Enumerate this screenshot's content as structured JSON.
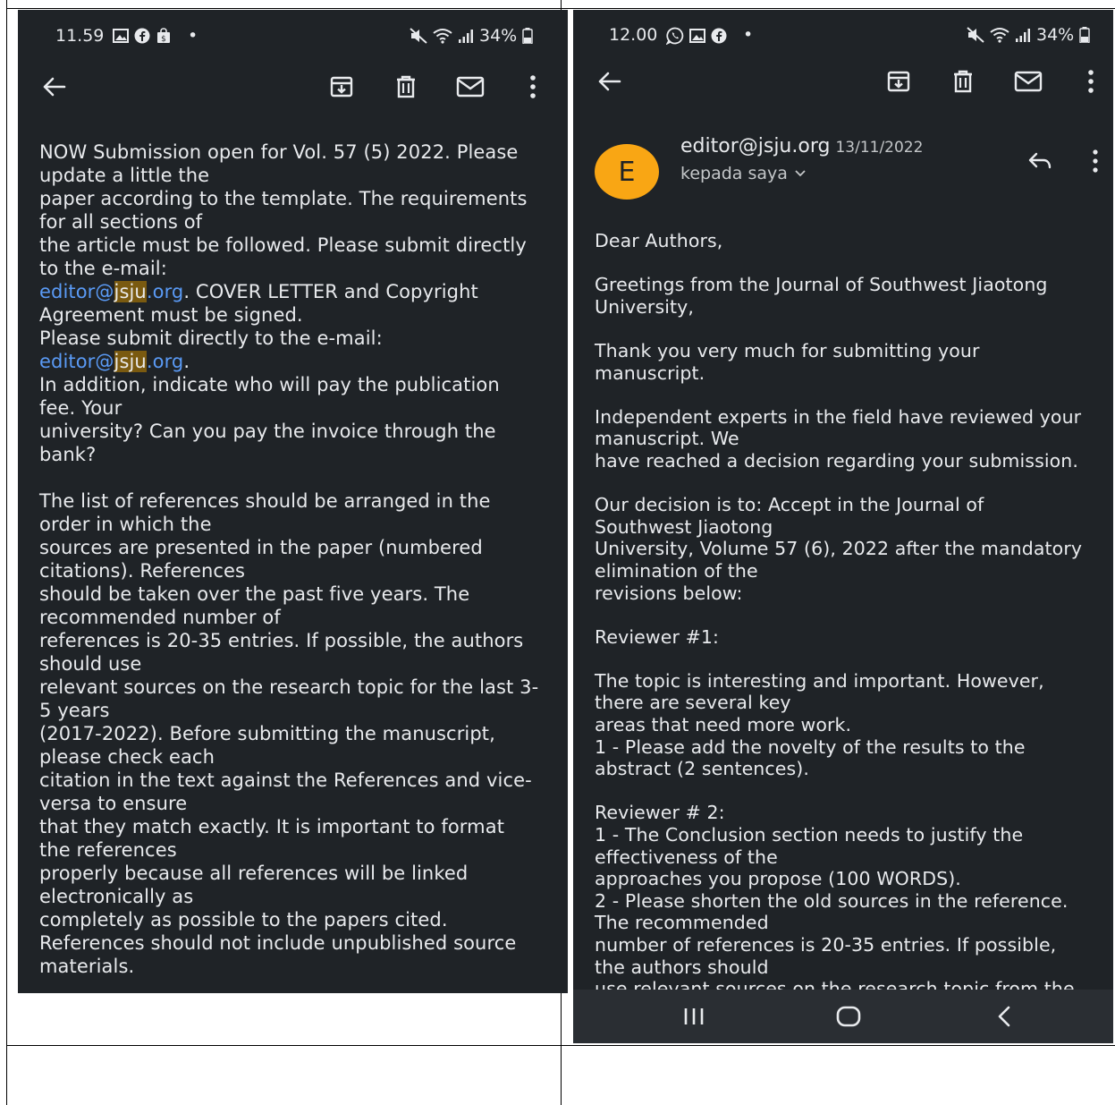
{
  "left_phone": {
    "status": {
      "time": "11.59",
      "dot": "•",
      "battery": "34%"
    },
    "body_lines": [
      "NOW Submission open for Vol. 57 (5) 2022. Please",
      "update a little the",
      "paper according to the template. The requirements",
      "for all sections of",
      "the article must be followed. Please submit directly",
      "to the e-mail:",
      "__LINK1__",
      "Agreement must be signed.",
      "Please submit directly to the e-mail:",
      "__LINK2__",
      "In addition, indicate who will pay the publication",
      "fee. Your",
      "university? Can you pay the invoice through the",
      "bank?",
      "",
      "The list of references should be arranged in the",
      "order in which the",
      "sources are presented in the paper (numbered",
      "citations). References",
      "should be taken over the past five years. The",
      "recommended number of",
      "references is 20-35 entries. If possible, the authors",
      "should use",
      "relevant sources on the research topic for the last 3-",
      "5 years",
      "(2017-2022). Before submitting the manuscript,",
      "please check each",
      "citation in the text against the References and vice-",
      "versa to ensure",
      "that they match exactly. It is important to format",
      "the references",
      "properly because all references will be linked",
      "electronically as",
      "completely as possible to the papers cited.",
      "References should not include unpublished source",
      "materials."
    ],
    "email_link": {
      "pre": "editor@",
      "highlight": "jsju",
      "post": ".org"
    },
    "after_link1": ". COVER LETTER and Copyright",
    "after_link2": "."
  },
  "right_phone": {
    "status": {
      "time": "12.00",
      "dot": "•",
      "battery": "34%"
    },
    "sender": {
      "initial": "E",
      "email": "editor@jsju.org",
      "date": "13/11/2022",
      "recipient": "kepada saya"
    },
    "body_lines": [
      "Dear Authors,",
      "",
      "Greetings from the Journal of Southwest Jiaotong",
      "University,",
      "",
      "Thank you very much for submitting your",
      "manuscript.",
      "",
      "Independent experts in the field have reviewed your",
      "manuscript. We",
      "have reached a decision regarding your submission.",
      "",
      "Our decision is to: Accept in the Journal of",
      "Southwest Jiaotong",
      "University, Volume 57 (6), 2022 after the mandatory",
      "elimination of the",
      "revisions below:",
      "",
      "Reviewer #1:",
      "",
      "The topic is interesting and important. However,",
      "there are several key",
      "areas that need more work.",
      "1 - Please add the novelty of the results to the",
      "abstract (2 sentences).",
      "",
      "Reviewer # 2:",
      "1 - The Conclusion section needs to justify the",
      "effectiveness of the",
      "approaches you propose (100 WORDS).",
      "2 - Please shorten the old sources in the reference.",
      "The recommended",
      "number of references is 20-35 entries. If possible,",
      "the authors should",
      "use relevant sources on the research topic from the"
    ]
  },
  "icons": {
    "back": "arrow-left-icon",
    "archive": "archive-icon",
    "delete": "trash-icon",
    "mail": "mail-icon",
    "more": "more-vert-icon",
    "reply": "reply-icon",
    "nav_recent": "recent-apps-icon",
    "nav_home": "home-icon",
    "nav_back": "nav-back-icon"
  },
  "colors": {
    "background": "#1f2327",
    "link": "#5a9af5",
    "highlight": "#7a5a10",
    "avatar": "#f9a614"
  }
}
